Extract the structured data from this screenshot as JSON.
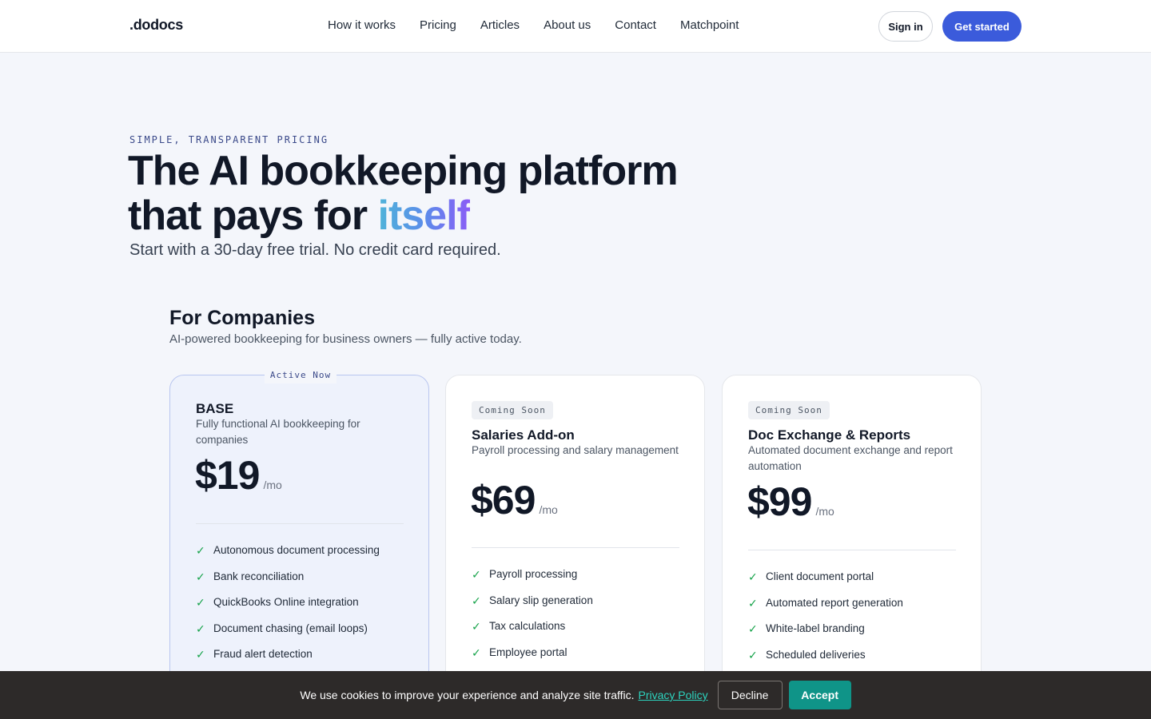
{
  "header": {
    "logo": ".dodocs",
    "nav": [
      "How it works",
      "Pricing",
      "Articles",
      "About us",
      "Contact",
      "Matchpoint"
    ],
    "sign_in": "Sign in",
    "get_started": "Get started"
  },
  "hero": {
    "eyebrow": "SIMPLE, TRANSPARENT PRICING",
    "headline_line1": "The AI bookkeeping platform",
    "headline_line2_prefix": "that pays for ",
    "headline_highlight": "itself",
    "subhead": "Start with a 30-day free trial. No credit card required."
  },
  "section": {
    "title": "For Companies",
    "subtitle": "AI-powered bookkeeping for business owners — fully active today."
  },
  "plans": [
    {
      "tag": "Active Now",
      "name": "BASE",
      "description": "Fully functional AI bookkeeping for companies",
      "price": "$19",
      "period": "/mo",
      "features": [
        "Autonomous document processing",
        "Bank reconciliation",
        "QuickBooks Online integration",
        "Document chasing (email loops)",
        "Fraud alert detection"
      ]
    },
    {
      "tag": "Coming Soon",
      "name": "Salaries Add-on",
      "description": "Payroll processing and salary management",
      "price": "$69",
      "period": "/mo",
      "features": [
        "Payroll processing",
        "Salary slip generation",
        "Tax calculations",
        "Employee portal"
      ]
    },
    {
      "tag": "Coming Soon",
      "name": "Doc Exchange & Reports",
      "description": "Automated document exchange and report automation",
      "price": "$99",
      "period": "/mo",
      "features": [
        "Client document portal",
        "Automated report generation",
        "White-label branding",
        "Scheduled deliveries"
      ]
    }
  ],
  "cookie": {
    "message": "We use cookies to improve your experience and analyze site traffic.",
    "link": "Privacy Policy",
    "decline": "Decline",
    "accept": "Accept"
  },
  "icons": {
    "feature_check": "check-icon"
  },
  "colors": {
    "accent": "#3b5bdb",
    "accept": "#0f9488",
    "check": "#16a34a"
  }
}
